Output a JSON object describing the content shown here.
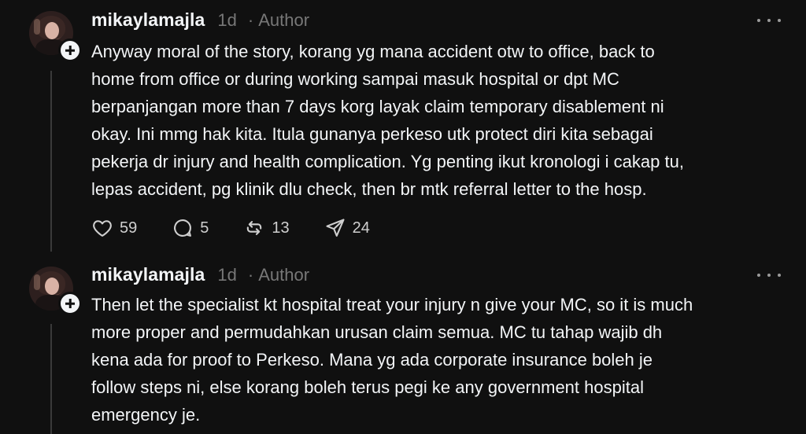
{
  "posts": [
    {
      "username": "mikaylamajla",
      "time": "1d",
      "separator": "·",
      "author_label": "Author",
      "text": "Anyway moral of the story, korang yg mana accident otw to office, back to\nhome from office or during working sampai masuk hospital or dpt MC\nberpanjangan more than 7 days korg layak claim temporary disablement ni\nokay. Ini mmg hak kita. Itula gunanya perkeso utk protect diri kita sebagai\npekerja dr injury and health complication. Yg penting ikut kronologi i cakap tu,\nlepas accident, pg klinik dlu check, then br mtk referral letter to the hosp.",
      "likes": "59",
      "replies": "5",
      "reposts": "13",
      "shares": "24"
    },
    {
      "username": "mikaylamajla",
      "time": "1d",
      "separator": "·",
      "author_label": "Author",
      "text": "Then let the specialist kt hospital treat your injury n give your MC, so it is much\nmore proper and permudahkan urusan claim semua. MC tu tahap wajib dh\nkena ada for proof to Perkeso. Mana yg ada corporate insurance boleh je\nfollow steps ni, else korang boleh terus pegi ke any government hospital\nemergency je."
    }
  ],
  "icons": {
    "like": "heart-icon",
    "reply": "comment-icon",
    "repost": "repost-icon",
    "share": "share-icon",
    "more": "more-icon",
    "follow": "plus-icon"
  },
  "colors": {
    "background": "#101010",
    "text": "#f3f5f7",
    "muted": "#777777"
  }
}
